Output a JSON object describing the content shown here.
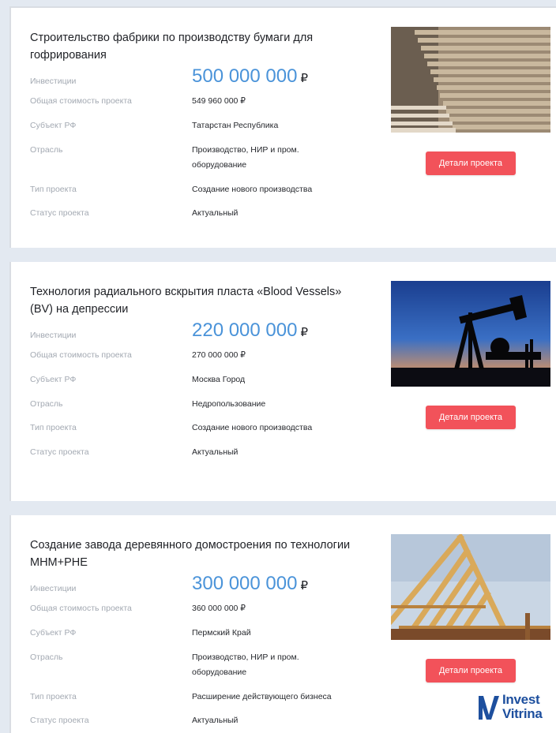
{
  "labels": {
    "investments": "Инвестиции",
    "total_cost": "Общая стоимость проекта",
    "region": "Субъект РФ",
    "industry": "Отрасль",
    "project_type": "Тип проекта",
    "project_status": "Статус проекта"
  },
  "currency_symbol": "₽",
  "projects": [
    {
      "title": "Строительство фабрики по производству бумаги для гофрирования",
      "investment": "500 000 000",
      "total_cost": "549 960 000 ₽",
      "region": "Татарстан Республика",
      "industry": "Производство, НИР и пром. оборудование",
      "project_type": "Создание нового производства",
      "status": "Актуальный",
      "button": "Детали проекта",
      "image": "corrugated-cardboard-stack-photo"
    },
    {
      "title": "Технология радиального вскрытия пласта «Blood Vessels» (BV) на депрессии",
      "investment": "220 000 000",
      "total_cost": "270 000 000 ₽",
      "region": "Москва Город",
      "industry": "Недропользование",
      "project_type": "Создание нового производства",
      "status": "Актуальный",
      "button": "Детали проекта",
      "image": "oil-pump-jack-sunset-photo"
    },
    {
      "title": "Создание завода деревянного домостроения по технологии MHM+PHE",
      "investment": "300 000 000",
      "total_cost": "360 000 000 ₽",
      "region": "Пермский Край",
      "industry": "Производство, НИР и пром. оборудование",
      "project_type": "Расширение действующего бизнеса",
      "status": "Актуальный",
      "button": "Детали проекта",
      "image": "wooden-roof-frame-photo"
    }
  ],
  "brand": {
    "line1": "Invest",
    "line2": "Vitrina",
    "color": "#1d4f9e"
  },
  "colors": {
    "accent_blue": "#4a93d9",
    "button_red": "#f2525a",
    "label_gray": "#a3a9b2",
    "background": "#e3e9f1"
  }
}
